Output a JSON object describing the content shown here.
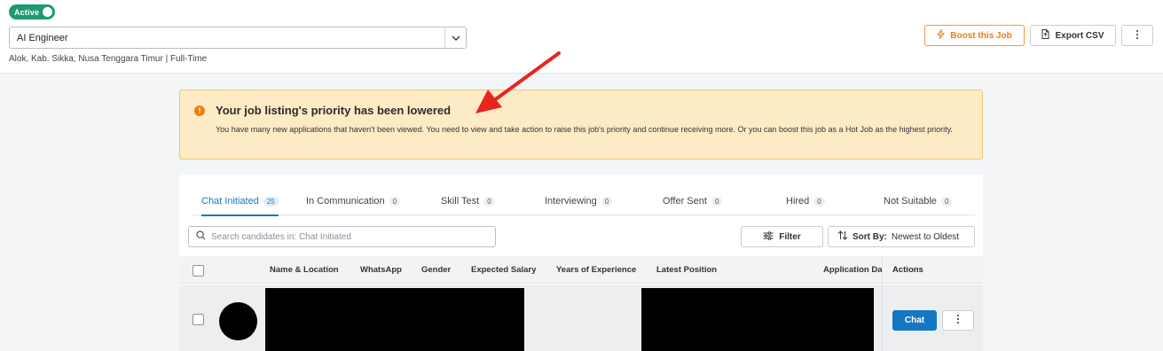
{
  "header": {
    "status_label": "Active",
    "job_title": "AI Engineer",
    "job_meta": "Alok, Kab. Sikka, Nusa Tenggara Timur | Full-Time",
    "boost_label": "Boost this Job",
    "export_label": "Export CSV"
  },
  "alert": {
    "icon": "!",
    "title": "Your job listing's priority has been lowered",
    "body": "You have many new applications that haven't been viewed. You need to view and take action to raise this job's priority and continue receiving more. Or you can boost this job as a Hot Job as the highest priority."
  },
  "tabs": [
    {
      "label": "Chat Initiated",
      "count": "25",
      "active": true
    },
    {
      "label": "In Communication",
      "count": "0"
    },
    {
      "label": "Skill Test",
      "count": "0"
    },
    {
      "label": "Interviewing",
      "count": "0"
    },
    {
      "label": "Offer Sent",
      "count": "0"
    },
    {
      "label": "Hired",
      "count": "0"
    },
    {
      "label": "Not Suitable",
      "count": "0"
    }
  ],
  "search": {
    "placeholder": "Search candidates in: Chat Initiated"
  },
  "toolbar": {
    "filter_label": "Filter",
    "sort_prefix": "Sort By:",
    "sort_value": "Newest to Oldest"
  },
  "table": {
    "columns": [
      "Name & Location",
      "WhatsApp",
      "Gender",
      "Expected Salary",
      "Years of Experience",
      "Latest Position",
      "Application Da",
      "Actions"
    ],
    "row": {
      "chat_label": "Chat"
    }
  },
  "colors": {
    "accent": "#1477c2",
    "active_status": "#1e9b6c",
    "warning_bg": "#fdebc6",
    "warning_icon": "#ef7d11",
    "annotation_arrow": "#e8241c"
  }
}
